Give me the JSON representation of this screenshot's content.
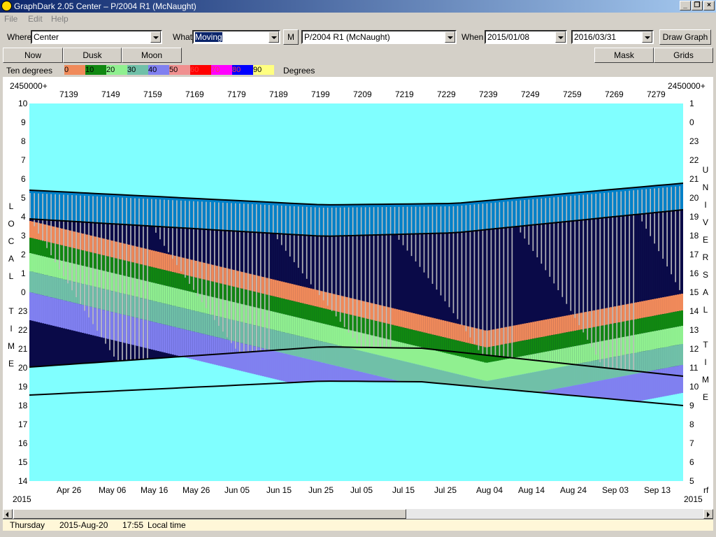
{
  "window": {
    "title": "GraphDark 2.05  Center  –  P/2004 R1 (McNaught)",
    "menu": [
      "File",
      "Edit",
      "Help"
    ]
  },
  "toolbar": {
    "where_label": "Where",
    "where_value": "Center",
    "what_label": "What",
    "what_value": "Moving",
    "m_label": "M",
    "object_value": "P/2004 R1 (McNaught)",
    "when_label": "When",
    "start_date": "2015/01/08",
    "end_date": "2016/03/31",
    "draw_label": "Draw Graph"
  },
  "buttons": {
    "now": "Now",
    "dusk": "Dusk",
    "moon": "Moon",
    "mask": "Mask",
    "grids": "Grids"
  },
  "legend": {
    "title": "Ten degrees",
    "unit": "Degrees",
    "items": [
      {
        "label": "0",
        "color": "#f08a5a"
      },
      {
        "label": "10",
        "color": "#118811"
      },
      {
        "label": "20",
        "color": "#90f090"
      },
      {
        "label": "30",
        "color": "#70c0a8"
      },
      {
        "label": "40",
        "color": "#8080f0"
      },
      {
        "label": "50",
        "color": "#f09090"
      },
      {
        "label": "60",
        "color": "#ff0000"
      },
      {
        "label": "70",
        "color": "#ff00ff"
      },
      {
        "label": "80",
        "color": "#0000ff"
      },
      {
        "label": "90",
        "color": "#ffff80"
      }
    ]
  },
  "chart": {
    "jd_prefix_left": "2450000+",
    "jd_prefix_right": "2450000+",
    "jd_ticks": [
      "7139",
      "7149",
      "7159",
      "7169",
      "7179",
      "7189",
      "7199",
      "7209",
      "7219",
      "7229",
      "7239",
      "7249",
      "7259",
      "7269",
      "7279"
    ],
    "date_ticks": [
      "Apr 26",
      "May 06",
      "May 16",
      "May 26",
      "Jun 05",
      "Jun 15",
      "Jun 25",
      "Jul 05",
      "Jul 15",
      "Jul 25",
      "Aug 04",
      "Aug 14",
      "Aug 24",
      "Sep 03",
      "Sep 13"
    ],
    "local_hours": [
      "10",
      "9",
      "8",
      "7",
      "6",
      "5",
      "4",
      "3",
      "2",
      "1",
      "0",
      "23",
      "22",
      "21",
      "20",
      "19",
      "18",
      "17",
      "16",
      "15",
      "14"
    ],
    "ut_hours": [
      "1",
      "0",
      "23",
      "22",
      "21",
      "20",
      "19",
      "18",
      "17",
      "16",
      "15",
      "14",
      "13",
      "12",
      "11",
      "10",
      "9",
      "8",
      "7",
      "6",
      "5"
    ],
    "left_vertical": [
      "L",
      "O",
      "C",
      "A",
      "L",
      "",
      "T",
      "I",
      "M",
      "E"
    ],
    "right_vertical": [
      "U",
      "N",
      "I",
      "V",
      "E",
      "R",
      "S",
      "A",
      "L",
      "",
      "T",
      "I",
      "M",
      "E"
    ],
    "year_left": "2015",
    "year_right": "2015",
    "corner_right": "rf",
    "colors": {
      "sky": "#80ffff",
      "night": "#0a0a48",
      "twilight": "#0080c8",
      "moon": "#c0c0c0"
    }
  },
  "status": {
    "day": "Thursday",
    "date": "2015-Aug-20",
    "time": "17:55",
    "mode": "Local time"
  }
}
